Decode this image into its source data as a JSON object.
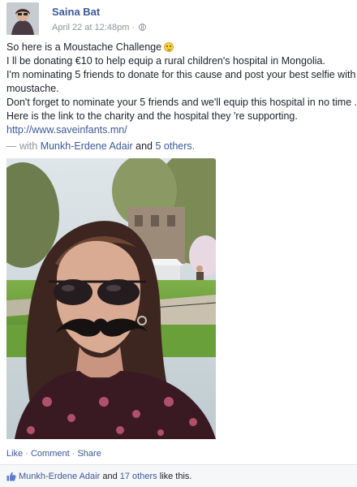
{
  "post": {
    "author": "Saina Bat",
    "date": "April 22 at 12:48pm",
    "date_separator": "·",
    "text_lines": [
      "So here is a Moustache Challenge",
      "I ll be donating €10 to help equip a rural children's hospital in Mongolia.",
      "I'm nominating 5 friends to donate for this cause and post your best selfie with",
      "moustache.",
      "Don't forget to nominate your 5 friends and we'll equip this hospital in no time .",
      "Here is the link to the charity and the hospital they 're supporting."
    ],
    "link": "http://www.saveinfants.mn/",
    "with_prefix": "— with",
    "with_name": "Munkh-Erdene Adair",
    "with_and": "and",
    "with_others": "5 others."
  },
  "actions": {
    "like": "Like",
    "comment": "Comment",
    "share": "Share",
    "separator": "·"
  },
  "likes": {
    "name": "Munkh-Erdene Adair",
    "and": "and",
    "others": "17 others",
    "suffix": "like this."
  },
  "colors": {
    "link_blue": "#3b5998",
    "meta_gray": "#90949c",
    "likes_bar_bg": "#f6f7f9"
  },
  "icons": {
    "globe": "globe-icon",
    "smiley": "smiley-emoji-icon",
    "like": "thumbs-up-icon"
  }
}
